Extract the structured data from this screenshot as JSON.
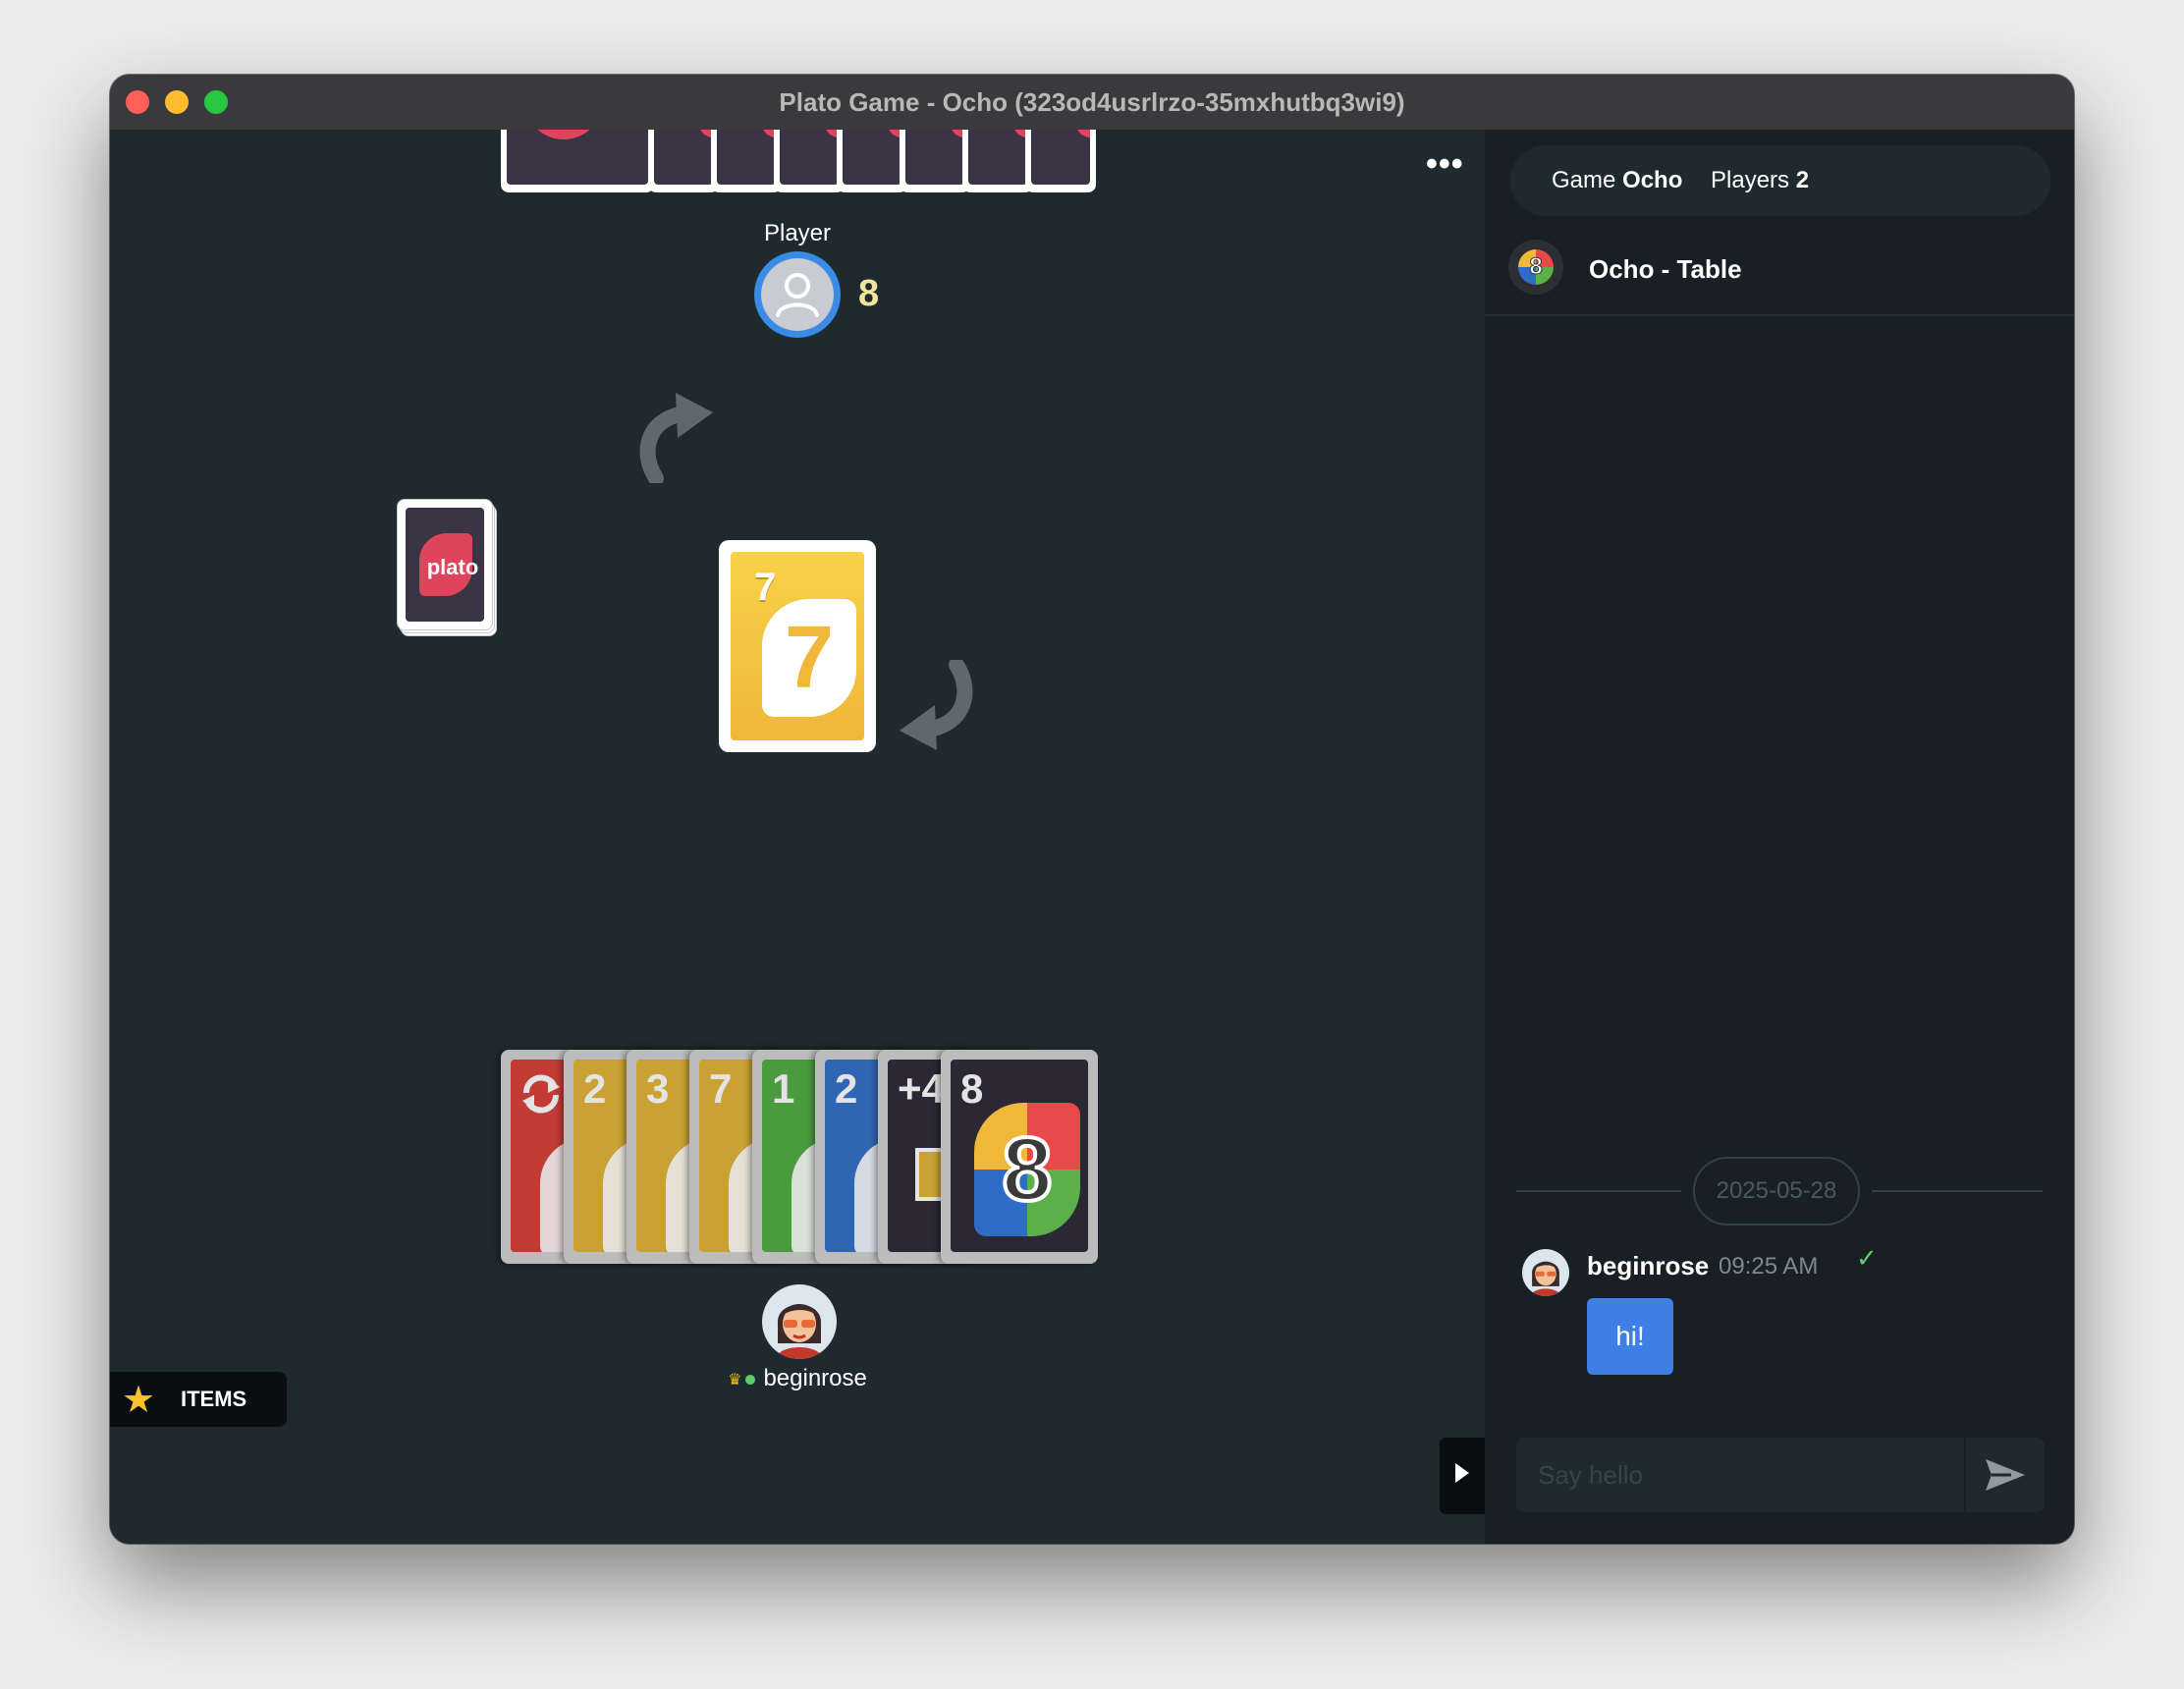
{
  "window": {
    "title": "Plato Game - Ocho (323od4usrlrzo-35mxhutbq3wi9)"
  },
  "opponent": {
    "name": "Player",
    "card_count": "8"
  },
  "deck": {
    "label": "plato"
  },
  "discard": {
    "value": "7",
    "color": "#f0b738"
  },
  "hand": [
    {
      "value": "",
      "color": "#c23b35",
      "icon": "reverse-icon"
    },
    {
      "value": "2",
      "color": "#c9a233"
    },
    {
      "value": "3",
      "color": "#c9a233"
    },
    {
      "value": "7",
      "color": "#c9a233"
    },
    {
      "value": "1",
      "color": "#4a9a3e"
    },
    {
      "value": "2",
      "color": "#2f66b4"
    },
    {
      "value": "+4",
      "color": "#2b2733"
    },
    {
      "value": "8",
      "color": "#2b2733",
      "icon": "wild-icon"
    }
  ],
  "me": {
    "name": "beginrose"
  },
  "items": {
    "label": "ITEMS"
  },
  "chat": {
    "game_label": "Game",
    "game_value": "Ocho",
    "players_label": "Players",
    "players_value": "2",
    "room_name": "Ocho - Table",
    "room_icon_value": "8",
    "date": "2025-05-28",
    "messages": [
      {
        "user": "beginrose",
        "time": "09:25 AM",
        "text": "hi!"
      }
    ],
    "input_placeholder": "Say hello"
  }
}
